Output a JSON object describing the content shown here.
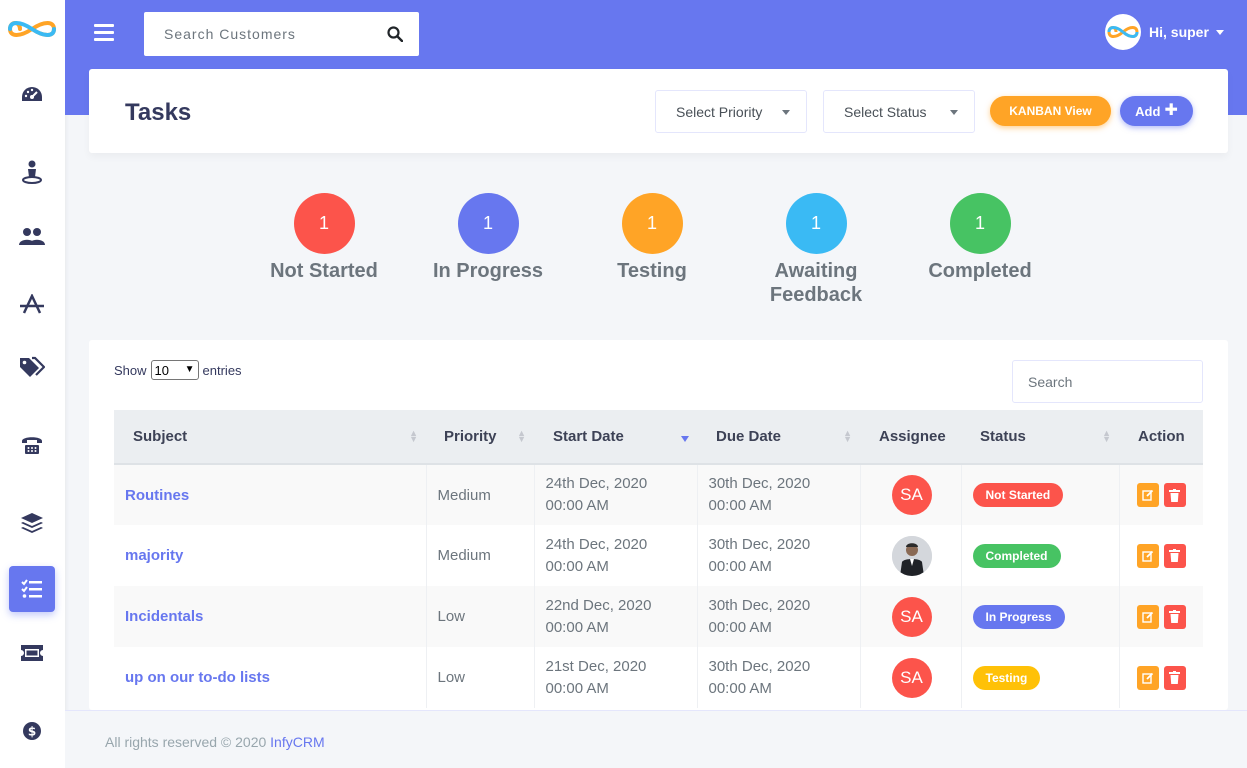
{
  "app": {
    "brand": "InfyCRM",
    "colors": {
      "primary": "#6777ef",
      "warning": "#ffa426",
      "danger": "#fc544b",
      "info": "#3abaf4",
      "success": "#47c363",
      "testing": "#ffc107"
    }
  },
  "sidebar": {
    "logo": "infinity-logo",
    "items": [
      {
        "icon": "dashboard-icon",
        "active": false
      },
      {
        "icon": "customer-icon",
        "active": false
      },
      {
        "icon": "members-icon",
        "active": false
      },
      {
        "icon": "leads-icon",
        "active": false
      },
      {
        "icon": "tags-icon",
        "active": false
      },
      {
        "icon": "phone-icon",
        "active": false
      },
      {
        "icon": "layers-icon",
        "active": false
      },
      {
        "icon": "tasks-icon",
        "active": true
      },
      {
        "icon": "ticket-icon",
        "active": false
      },
      {
        "icon": "payment-icon",
        "active": false
      }
    ]
  },
  "topbar": {
    "search_placeholder": "Search Customers",
    "user_greeting": "Hi, super"
  },
  "header": {
    "title": "Tasks",
    "priority_select": "Select Priority",
    "status_select": "Select Status",
    "kanban_label": "KANBAN View",
    "add_label": "Add"
  },
  "counters": [
    {
      "count": "1",
      "label": "Not Started",
      "color": "#fc544b"
    },
    {
      "count": "1",
      "label": "In Progress",
      "color": "#6777ef"
    },
    {
      "count": "1",
      "label": "Testing",
      "color": "#ffa426"
    },
    {
      "count": "1",
      "label": "Awaiting Feedback",
      "color": "#3abaf4"
    },
    {
      "count": "1",
      "label": "Completed",
      "color": "#47c363"
    }
  ],
  "table": {
    "show_label": "Show",
    "entries_value": "10",
    "entries_label": "entries",
    "search_placeholder": "Search",
    "columns": [
      "Subject",
      "Priority",
      "Start Date",
      "Due Date",
      "Assignee",
      "Status",
      "Action"
    ],
    "rows": [
      {
        "subject": "Routines",
        "priority": "Medium",
        "start_date": "24th Dec, 2020",
        "start_time": "00:00 AM",
        "due_date": "30th Dec, 2020",
        "due_time": "00:00 AM",
        "assignee": "SA",
        "assignee_type": "initials",
        "status": "Not Started",
        "status_color": "#fc544b"
      },
      {
        "subject": "majority",
        "priority": "Medium",
        "start_date": "24th Dec, 2020",
        "start_time": "00:00 AM",
        "due_date": "30th Dec, 2020",
        "due_time": "00:00 AM",
        "assignee": "",
        "assignee_type": "photo",
        "status": "Completed",
        "status_color": "#47c363"
      },
      {
        "subject": "Incidentals",
        "priority": "Low",
        "start_date": "22nd Dec, 2020",
        "start_time": "00:00 AM",
        "due_date": "30th Dec, 2020",
        "due_time": "00:00 AM",
        "assignee": "SA",
        "assignee_type": "initials",
        "status": "In Progress",
        "status_color": "#6777ef"
      },
      {
        "subject": "up on our to-do lists",
        "priority": "Low",
        "start_date": "21st Dec, 2020",
        "start_time": "00:00 AM",
        "due_date": "30th Dec, 2020",
        "due_time": "00:00 AM",
        "assignee": "SA",
        "assignee_type": "initials",
        "status": "Testing",
        "status_color": "#ffc107"
      }
    ]
  },
  "footer": {
    "text": "All rights reserved © 2020 ",
    "link": "InfyCRM"
  }
}
